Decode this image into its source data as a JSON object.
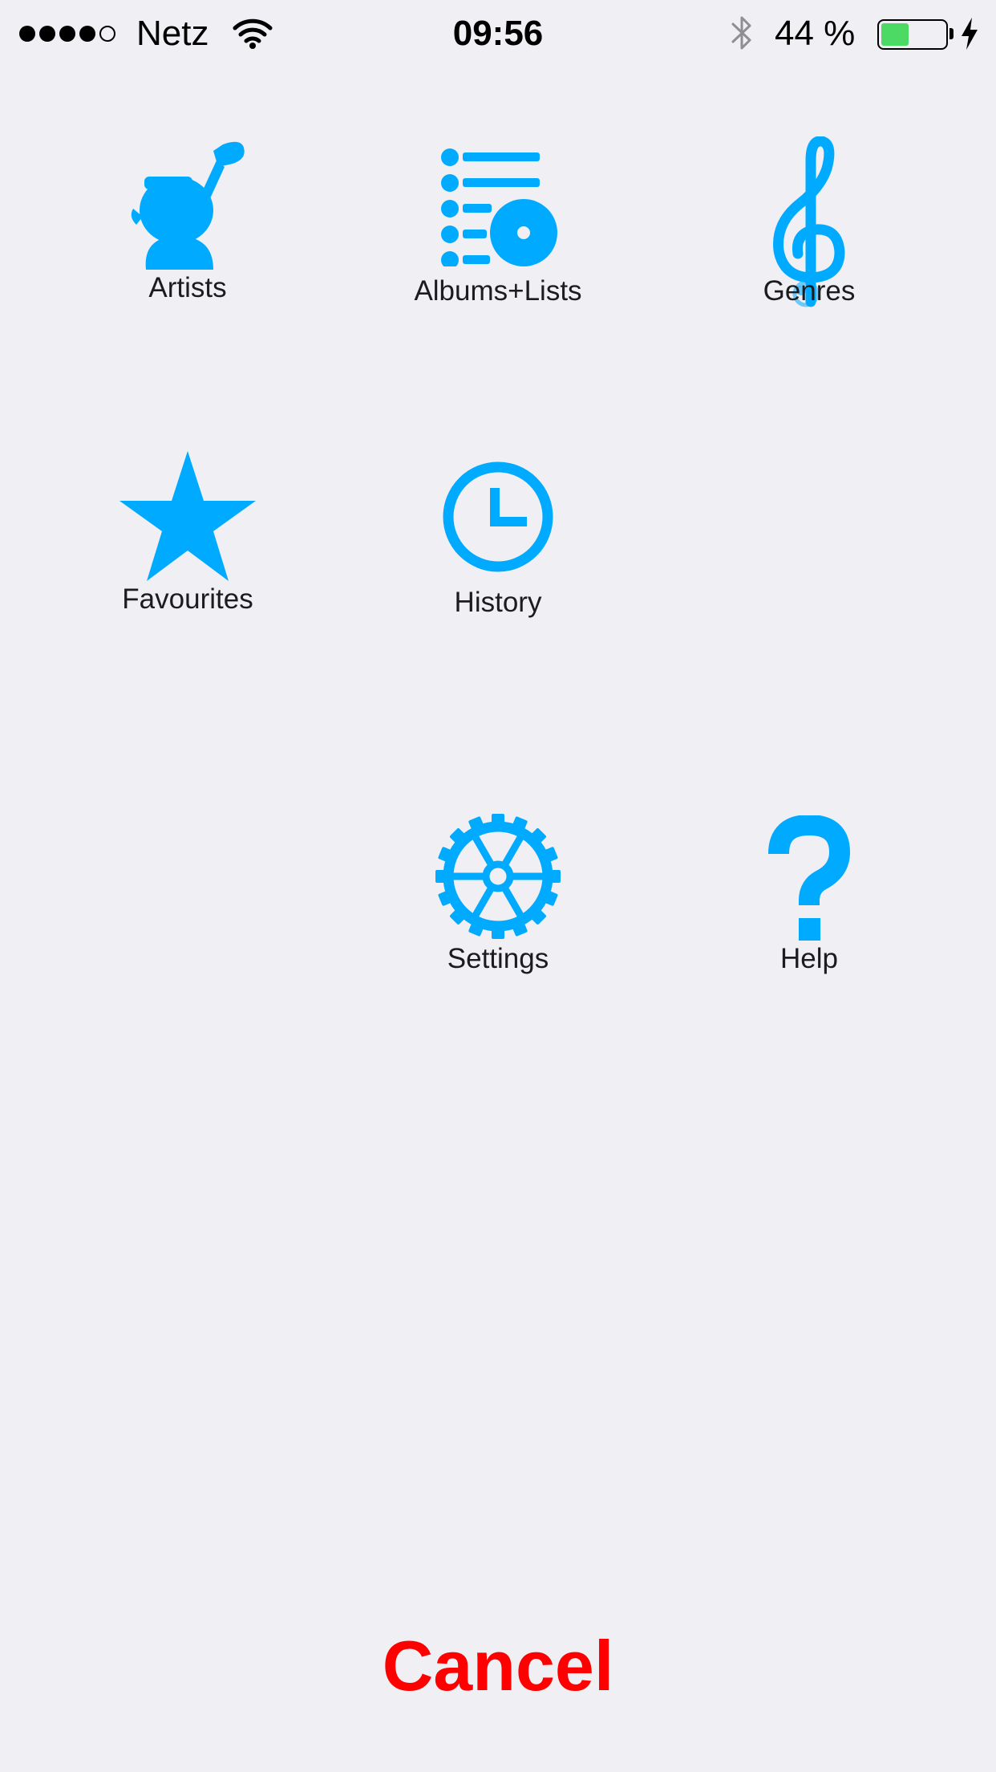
{
  "status_bar": {
    "carrier": "Netz",
    "time": "09:56",
    "battery_text": "44 %",
    "battery_level": 0.44,
    "signal_bars_filled": 4,
    "signal_bars_total": 5
  },
  "menu": {
    "artists_label": "Artists",
    "albums_label": "Albums+Lists",
    "genres_label": "Genres",
    "favourites_label": "Favourites",
    "history_label": "History",
    "settings_label": "Settings",
    "help_label": "Help"
  },
  "cancel_label": "Cancel",
  "colors": {
    "icon": "#00aaff",
    "cancel": "#ff0000",
    "background": "#efeff4",
    "battery_fill": "#4cd964"
  }
}
